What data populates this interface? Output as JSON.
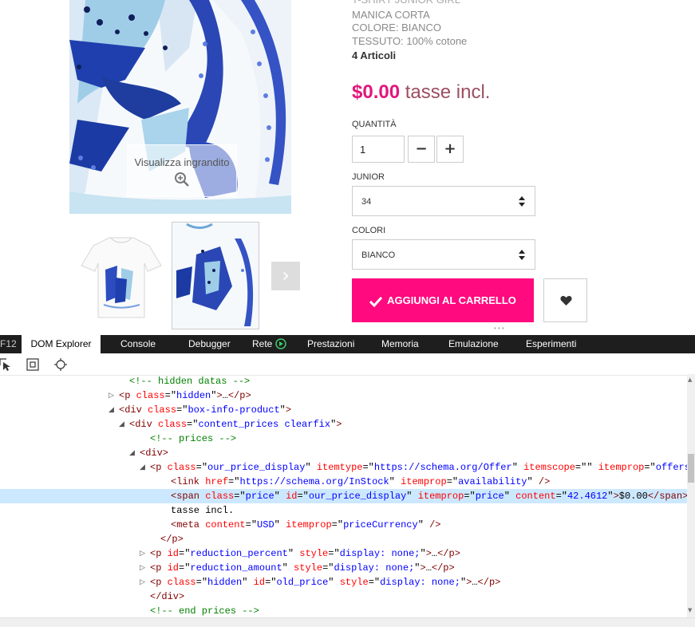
{
  "product": {
    "description_lines": [
      "T-SHIRT JUNIOR GIRL",
      "MANICA CORTA",
      "COLORE: BIANCO",
      "TESSUTO: 100% cotone"
    ],
    "articles": "4 Articoli",
    "price": "$0.00",
    "tax_label": "tasse incl.",
    "quantity_label": "QUANTITÀ",
    "quantity_value": "1",
    "size_label": "JUNIOR",
    "size_value": "34",
    "color_label": "COLORI",
    "color_value": "BIANCO",
    "add_to_cart": "AGGIUNGI AL CARRELLO",
    "zoom_label": "Visualizza ingrandito",
    "accent_color": "#ff0a7f"
  },
  "devtools": {
    "f12": "F12",
    "tabs": [
      "DOM Explorer",
      "Console",
      "Debugger",
      "Rete",
      "Prestazioni",
      "Memoria",
      "Emulazione",
      "Esperimenti"
    ],
    "active_tab": "DOM Explorer",
    "tree": [
      {
        "twisty": "",
        "tokens": [
          [
            "comment",
            "<!-- hidden datas -->"
          ]
        ]
      },
      {
        "twisty": "collapsed",
        "tokens": [
          [
            "tag",
            "<p "
          ],
          [
            "attr",
            "class"
          ],
          [
            "plain",
            "=\""
          ],
          [
            "val",
            "hidden"
          ],
          [
            "plain",
            "\""
          ],
          [
            "tag",
            ">"
          ],
          [
            "plain",
            "…"
          ],
          [
            "tag",
            "</p>"
          ]
        ]
      },
      {
        "twisty": "expanded",
        "tokens": [
          [
            "tag",
            "<div "
          ],
          [
            "attr",
            "class"
          ],
          [
            "plain",
            "=\""
          ],
          [
            "val",
            "box-info-product"
          ],
          [
            "plain",
            "\""
          ],
          [
            "tag",
            ">"
          ]
        ]
      },
      {
        "twisty": "expanded",
        "tokens": [
          [
            "tag",
            "<div "
          ],
          [
            "attr",
            "class"
          ],
          [
            "plain",
            "=\""
          ],
          [
            "val",
            "content_prices clearfix"
          ],
          [
            "plain",
            "\""
          ],
          [
            "tag",
            ">"
          ]
        ]
      },
      {
        "twisty": "",
        "tokens": [
          [
            "comment",
            "<!-- prices -->"
          ]
        ]
      },
      {
        "twisty": "expanded",
        "tokens": [
          [
            "tag",
            "<div>"
          ]
        ]
      },
      {
        "twisty": "expanded",
        "tokens": [
          [
            "tag",
            "<p "
          ],
          [
            "attr",
            "class"
          ],
          [
            "plain",
            "=\""
          ],
          [
            "val",
            "our_price_display"
          ],
          [
            "plain",
            "\" "
          ],
          [
            "attr",
            "itemtype"
          ],
          [
            "plain",
            "=\""
          ],
          [
            "val",
            "https://schema.org/Offer"
          ],
          [
            "plain",
            "\" "
          ],
          [
            "attr",
            "itemscope"
          ],
          [
            "plain",
            "=\"\" "
          ],
          [
            "attr",
            "itemprop"
          ],
          [
            "plain",
            "=\""
          ],
          [
            "val",
            "offers"
          ],
          [
            "plain",
            "\""
          ],
          [
            "tag",
            ">"
          ]
        ]
      },
      {
        "twisty": "",
        "tokens": [
          [
            "tag",
            "<link "
          ],
          [
            "attr",
            "href"
          ],
          [
            "plain",
            "=\""
          ],
          [
            "val",
            "https://schema.org/InStock"
          ],
          [
            "plain",
            "\" "
          ],
          [
            "attr",
            "itemprop"
          ],
          [
            "plain",
            "=\""
          ],
          [
            "val",
            "availability"
          ],
          [
            "plain",
            "\" "
          ],
          [
            "tag",
            "/>"
          ]
        ]
      },
      {
        "twisty": "",
        "selected": true,
        "tokens": [
          [
            "tag",
            "<span "
          ],
          [
            "attr",
            "class"
          ],
          [
            "plain",
            "=\""
          ],
          [
            "val",
            "price"
          ],
          [
            "plain",
            "\" "
          ],
          [
            "attr",
            "id"
          ],
          [
            "plain",
            "=\""
          ],
          [
            "val",
            "our_price_display"
          ],
          [
            "plain",
            "\" "
          ],
          [
            "attr",
            "itemprop"
          ],
          [
            "plain",
            "=\""
          ],
          [
            "val",
            "price"
          ],
          [
            "plain",
            "\" "
          ],
          [
            "attr",
            "content"
          ],
          [
            "plain",
            "=\""
          ],
          [
            "val",
            "42.4612"
          ],
          [
            "plain",
            "\""
          ],
          [
            "tag",
            ">"
          ],
          [
            "plain",
            "$0.00"
          ],
          [
            "tag",
            "</span>"
          ]
        ]
      },
      {
        "twisty": "",
        "tokens": [
          [
            "plain",
            "tasse incl."
          ]
        ]
      },
      {
        "twisty": "",
        "tokens": [
          [
            "tag",
            "<meta "
          ],
          [
            "attr",
            "content"
          ],
          [
            "plain",
            "=\""
          ],
          [
            "val",
            "USD"
          ],
          [
            "plain",
            "\" "
          ],
          [
            "attr",
            "itemprop"
          ],
          [
            "plain",
            "=\""
          ],
          [
            "val",
            "priceCurrency"
          ],
          [
            "plain",
            "\" "
          ],
          [
            "tag",
            "/>"
          ]
        ]
      },
      {
        "twisty": "",
        "tokens": [
          [
            "tag",
            "</p>"
          ]
        ]
      },
      {
        "twisty": "collapsed",
        "tokens": [
          [
            "tag",
            "<p "
          ],
          [
            "attr",
            "id"
          ],
          [
            "plain",
            "=\""
          ],
          [
            "val",
            "reduction_percent"
          ],
          [
            "plain",
            "\" "
          ],
          [
            "attr",
            "style"
          ],
          [
            "plain",
            "=\""
          ],
          [
            "val",
            "display: none;"
          ],
          [
            "plain",
            "\""
          ],
          [
            "tag",
            ">"
          ],
          [
            "plain",
            "…"
          ],
          [
            "tag",
            "</p>"
          ]
        ]
      },
      {
        "twisty": "collapsed",
        "tokens": [
          [
            "tag",
            "<p "
          ],
          [
            "attr",
            "id"
          ],
          [
            "plain",
            "=\""
          ],
          [
            "val",
            "reduction_amount"
          ],
          [
            "plain",
            "\" "
          ],
          [
            "attr",
            "style"
          ],
          [
            "plain",
            "=\""
          ],
          [
            "val",
            "display: none;"
          ],
          [
            "plain",
            "\""
          ],
          [
            "tag",
            ">"
          ],
          [
            "plain",
            "…"
          ],
          [
            "tag",
            "</p>"
          ]
        ]
      },
      {
        "twisty": "collapsed",
        "tokens": [
          [
            "tag",
            "<p "
          ],
          [
            "attr",
            "class"
          ],
          [
            "plain",
            "=\""
          ],
          [
            "val",
            "hidden"
          ],
          [
            "plain",
            "\" "
          ],
          [
            "attr",
            "id"
          ],
          [
            "plain",
            "=\""
          ],
          [
            "val",
            "old_price"
          ],
          [
            "plain",
            "\" "
          ],
          [
            "attr",
            "style"
          ],
          [
            "plain",
            "=\""
          ],
          [
            "val",
            "display: none;"
          ],
          [
            "plain",
            "\""
          ],
          [
            "tag",
            ">"
          ],
          [
            "plain",
            "…"
          ],
          [
            "tag",
            "</p>"
          ]
        ]
      },
      {
        "twisty": "",
        "tokens": [
          [
            "tag",
            "</div>"
          ]
        ]
      },
      {
        "twisty": "",
        "tokens": [
          [
            "comment",
            "<!-- end prices -->"
          ]
        ]
      }
    ]
  }
}
